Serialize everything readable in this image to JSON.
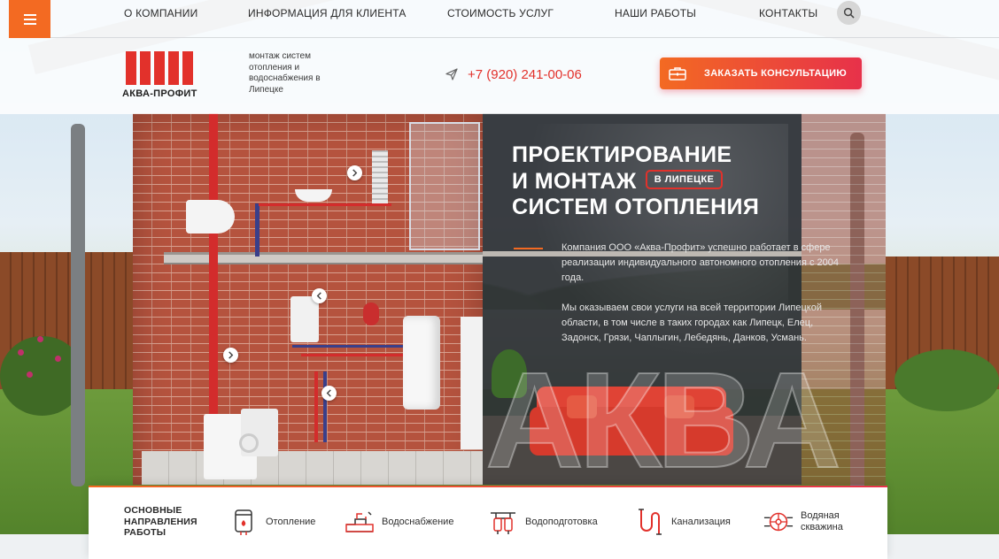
{
  "nav": {
    "items": [
      "О КОМПАНИИ",
      "ИНФОРМАЦИЯ ДЛЯ КЛИЕНТА",
      "СТОИМОСТЬ УСЛУГ",
      "НАШИ РАБОТЫ",
      "КОНТАКТЫ"
    ]
  },
  "header": {
    "logo_text": "АКВА-ПРОФИТ",
    "tagline": "монтаж систем отопления и водоснабжения в Липецке",
    "phone": "+7 (920) 241-00-06",
    "cta_label": "ЗАКАЗАТЬ КОНСУЛЬТАЦИЮ"
  },
  "hero": {
    "title_line1": "ПРОЕКТИРОВАНИЕ",
    "title_line2": "И МОНТАЖ",
    "badge": "В ЛИПЕЦКЕ",
    "title_line3": "СИСТЕМ ОТОПЛЕНИЯ",
    "paragraph1": "Компания ООО «Аква-Профит» успешно работает в сфере реализации индивидуального автономного отопления с 2004 года.",
    "paragraph2": "Мы оказываем свои услуги на всей территории Липецкой области, в том числе в таких городах как Липецк, Елец, Задонск, Грязи, Чаплыгин, Лебедянь, Данков, Усмань.",
    "watermark": "АКВА"
  },
  "services": {
    "heading": "ОСНОВНЫЕ НАПРАВЛЕНИЯ РАБОТЫ",
    "items": [
      {
        "label": "Отопление",
        "icon": "boiler-icon"
      },
      {
        "label": "Водоснабжение",
        "icon": "faucet-pipe-icon"
      },
      {
        "label": "Водоподготовка",
        "icon": "water-filter-icon"
      },
      {
        "label": "Канализация",
        "icon": "sewer-pipe-icon"
      },
      {
        "label": "Водяная скважина",
        "icon": "well-pump-icon"
      }
    ]
  },
  "colors": {
    "accent_orange": "#f36a22",
    "accent_red": "#e2312b",
    "cta_gradient_end": "#e7314a"
  }
}
